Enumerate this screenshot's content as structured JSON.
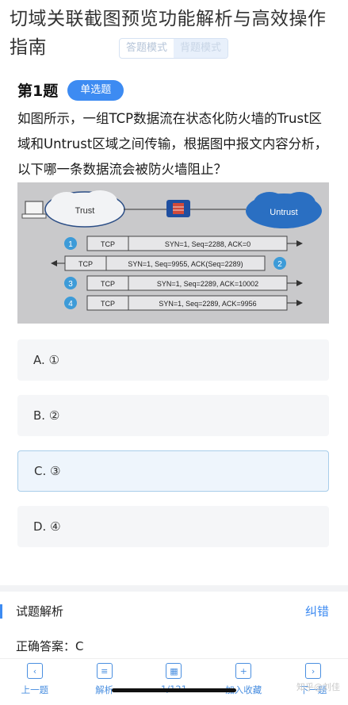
{
  "caption": {
    "title": "切域关联截图预览功能解析与高效操作指南"
  },
  "mode_switch": {
    "answer_mode": "答题模式",
    "recite_mode": "背题模式"
  },
  "question": {
    "number": "第1题",
    "type": "单选题",
    "text": "如图所示，一组TCP数据流在状态化防火墙的Trust区域和Untrust区域之间传输，根据图中报文内容分析，以下哪一条数据流会被防火墙阻止？"
  },
  "figure": {
    "trust_label": "Trust",
    "untrust_label": "Untrust",
    "rows": [
      {
        "num": "1",
        "proto": "TCP",
        "info": "SYN=1, Seq=2288, ACK=0"
      },
      {
        "num": "2",
        "proto": "TCP",
        "info": "SYN=1, Seq=9955, ACK(Seq=2289)"
      },
      {
        "num": "3",
        "proto": "TCP",
        "info": "SYN=1, Seq=2289, ACK=10002"
      },
      {
        "num": "4",
        "proto": "TCP",
        "info": "SYN=1, Seq=2289, ACK=9956"
      }
    ],
    "colors": {
      "background": "#c9c9cb",
      "trust_cloud": "#f2f3f5",
      "untrust_cloud": "#2a6fc2",
      "number_badge": "#3d9bd8"
    }
  },
  "options": [
    {
      "label": "A. ①",
      "selected": false
    },
    {
      "label": "B. ②",
      "selected": false
    },
    {
      "label": "C. ③",
      "selected": true
    },
    {
      "label": "D. ④",
      "selected": false
    }
  ],
  "analysis": {
    "title": "试题解析",
    "report_link": "纠错",
    "answer": "正确答案：C"
  },
  "bottom_nav": [
    {
      "icon": "chevron-left-icon",
      "glyph": "‹",
      "label": "上一题"
    },
    {
      "icon": "document-icon",
      "glyph": "≡",
      "label": "解析"
    },
    {
      "icon": "grid-icon",
      "glyph": "▦",
      "label": "1/121"
    },
    {
      "icon": "bookmark-add-icon",
      "glyph": "+",
      "label": "加入收藏"
    },
    {
      "icon": "chevron-right-icon",
      "glyph": "›",
      "label": "下一题"
    }
  ],
  "watermark": "知乎@刘佳",
  "colors": {
    "accent": "#3d8bf2",
    "selected_bg": "#eef5fc",
    "selected_border": "#a8cdea",
    "option_bg": "#f5f6f8"
  }
}
